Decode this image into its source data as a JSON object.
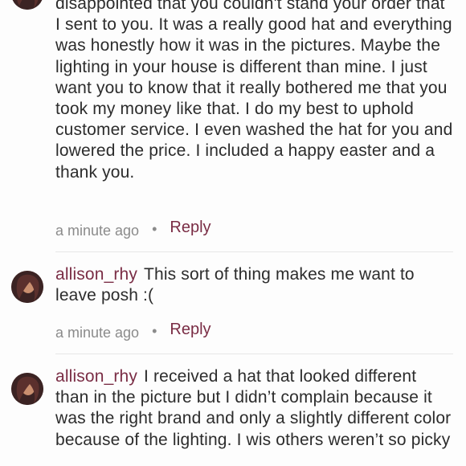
{
  "comments": [
    {
      "username": "",
      "text": "disappointed that you couldn't stand your order that I sent to you. It was a really good hat and everything was honestly how it was in the pictures. Maybe the lighting in your house is different than mine. I just want you to know that it really bothered me that you took my money like that. I do my best to uphold customer service. I even washed the hat for you and lowered the price. I included a happy easter and a thank you.",
      "time": "a minute ago",
      "reply_label": "Reply"
    },
    {
      "username": "allison_rhy",
      "text": "This sort of thing makes me want to leave posh :(",
      "time": "a minute ago",
      "reply_label": "Reply"
    },
    {
      "username": "allison_rhy",
      "text": "I received a hat that looked different than in the picture but I didn’t complain because it was the right brand and only a slightly different color because of the lighting. I wis others weren’t so picky",
      "time": "",
      "reply_label": ""
    }
  ],
  "colors": {
    "username": "#7a2d45",
    "reply": "#7a2d45",
    "meta": "#8b8b8b",
    "divider": "#e6e6e6"
  },
  "icons": {
    "avatar": "profile-photo-avatar"
  }
}
